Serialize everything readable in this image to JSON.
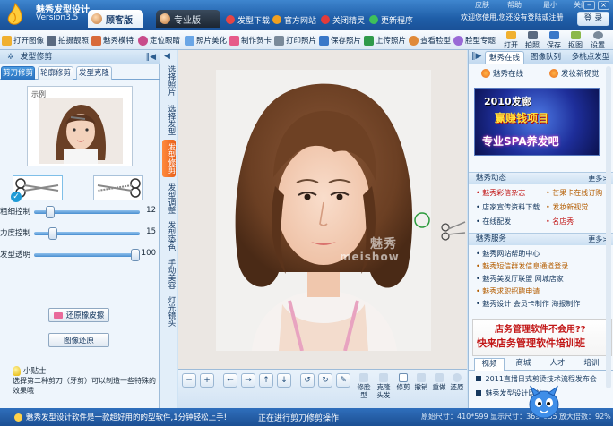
{
  "title_bar": {
    "app_name": "魅秀发型设计",
    "version": "Version3.5",
    "edition_active": "顾客版",
    "edition_inactive": "专业版",
    "links": [
      "发型下载",
      "官方网站",
      "关闭精灵",
      "更新程序"
    ],
    "window_small": [
      "皮肤",
      "帮助",
      "最小",
      "关闭"
    ],
    "welcome": "欢迎您使用,您还没有登陆或注册",
    "login_button": "登 录"
  },
  "toolbar": {
    "tools": [
      "打开图像",
      "拍摄靓照",
      "魅秀模特",
      "定位眼睛",
      "照片美化",
      "制作贺卡",
      "打印照片",
      "保存照片",
      "上传照片",
      "查看脸型",
      "脸型专题"
    ],
    "big_tools": [
      "打开",
      "拍照",
      "保存",
      "抠图",
      "设置"
    ]
  },
  "left_panel": {
    "heading": "发型修剪",
    "subtabs": [
      "剪刀修剪",
      "轮廓修剪",
      "发型克隆"
    ],
    "sample_label": "示例",
    "sliders": [
      {
        "label": "粗细控制",
        "value": 12,
        "max": 100
      },
      {
        "label": "力度控制",
        "value": 15,
        "max": 100
      },
      {
        "label": "发型透明",
        "value": 100,
        "max": 100
      }
    ],
    "restore_eraser_button": "还原橡皮擦",
    "restore_image_button": "图像还原",
    "tip_title": "小贴士",
    "tip_body": "选择第二种剪刀（牙剪）可以制造一些特殊的效果哦"
  },
  "vertical_tabs": [
    "选择照片",
    "选择发型",
    "发型修剪",
    "发型调整",
    "发型染色",
    "手动美容",
    "灯光镜头"
  ],
  "canvas": {
    "watermark_cn": "魅秀",
    "watermark_en": "meishow"
  },
  "canvas_tools": {
    "labels": [
      "修脸型",
      "克隆头发",
      "修剪",
      "撤销",
      "重做",
      "还原"
    ]
  },
  "right_panel": {
    "tabs": [
      "魅秀在线",
      "图像队列",
      "多桃点发型"
    ],
    "online_items": [
      "魅秀在线",
      "发妆新视觉"
    ],
    "ad_banner": {
      "line1": "2010发廊",
      "line2": "赢赚钱项目",
      "line3": "专业SPA养发吧"
    },
    "news_section": "魅秀动态",
    "news": [
      {
        "text": "• 魅秀彩信杂志",
        "color": "red"
      },
      {
        "text": "• 芒果卡在线订购",
        "color": "orange"
      },
      {
        "text": "• 店家宣传资料下载",
        "color": "blue"
      },
      {
        "text": "• 发妆新视觉",
        "color": "orange"
      },
      {
        "text": "• 在线配发",
        "color": "blue"
      },
      {
        "text": "• 名店秀",
        "color": "red"
      }
    ],
    "service_section": "魅秀服务",
    "services": [
      {
        "text": "• 魅秀网站帮助中心",
        "color": "blue"
      },
      {
        "text": "• 魅秀短信群发信息通道登录",
        "color": "orange"
      },
      {
        "text": "• 魅秀美发厅联盟 网城店家",
        "color": "blue"
      },
      {
        "text": "• 魅秀求职招聘申请",
        "color": "orange"
      },
      {
        "text": "• 魅秀设计  会员卡制作  海报制作",
        "color": "blue"
      }
    ],
    "more_label": "更多>",
    "ad2": {
      "line1": "店务管理软件不会用??",
      "line2": "快来店务管理软件培训班"
    },
    "bottom_tabs": [
      "视频",
      "商城",
      "人才",
      "培训"
    ],
    "bottom_news": [
      "2011直播日式剪烫技术流程发布会",
      "魅秀发型设计网站"
    ]
  },
  "status_bar": {
    "left": "魅秀发型设计软件是一款超好用的的型软件,1分钟轻松上手!",
    "mid": "正在进行剪刀修剪操作",
    "size": "原始尺寸：410*599  显示尺寸：369*555",
    "zoom": "放大倍数：92%"
  },
  "colors": {
    "title_blue": "#1f5ea8",
    "accent_orange": "#e8601a",
    "news_red": "#c21717",
    "panel_bg": "#eef5fc"
  }
}
